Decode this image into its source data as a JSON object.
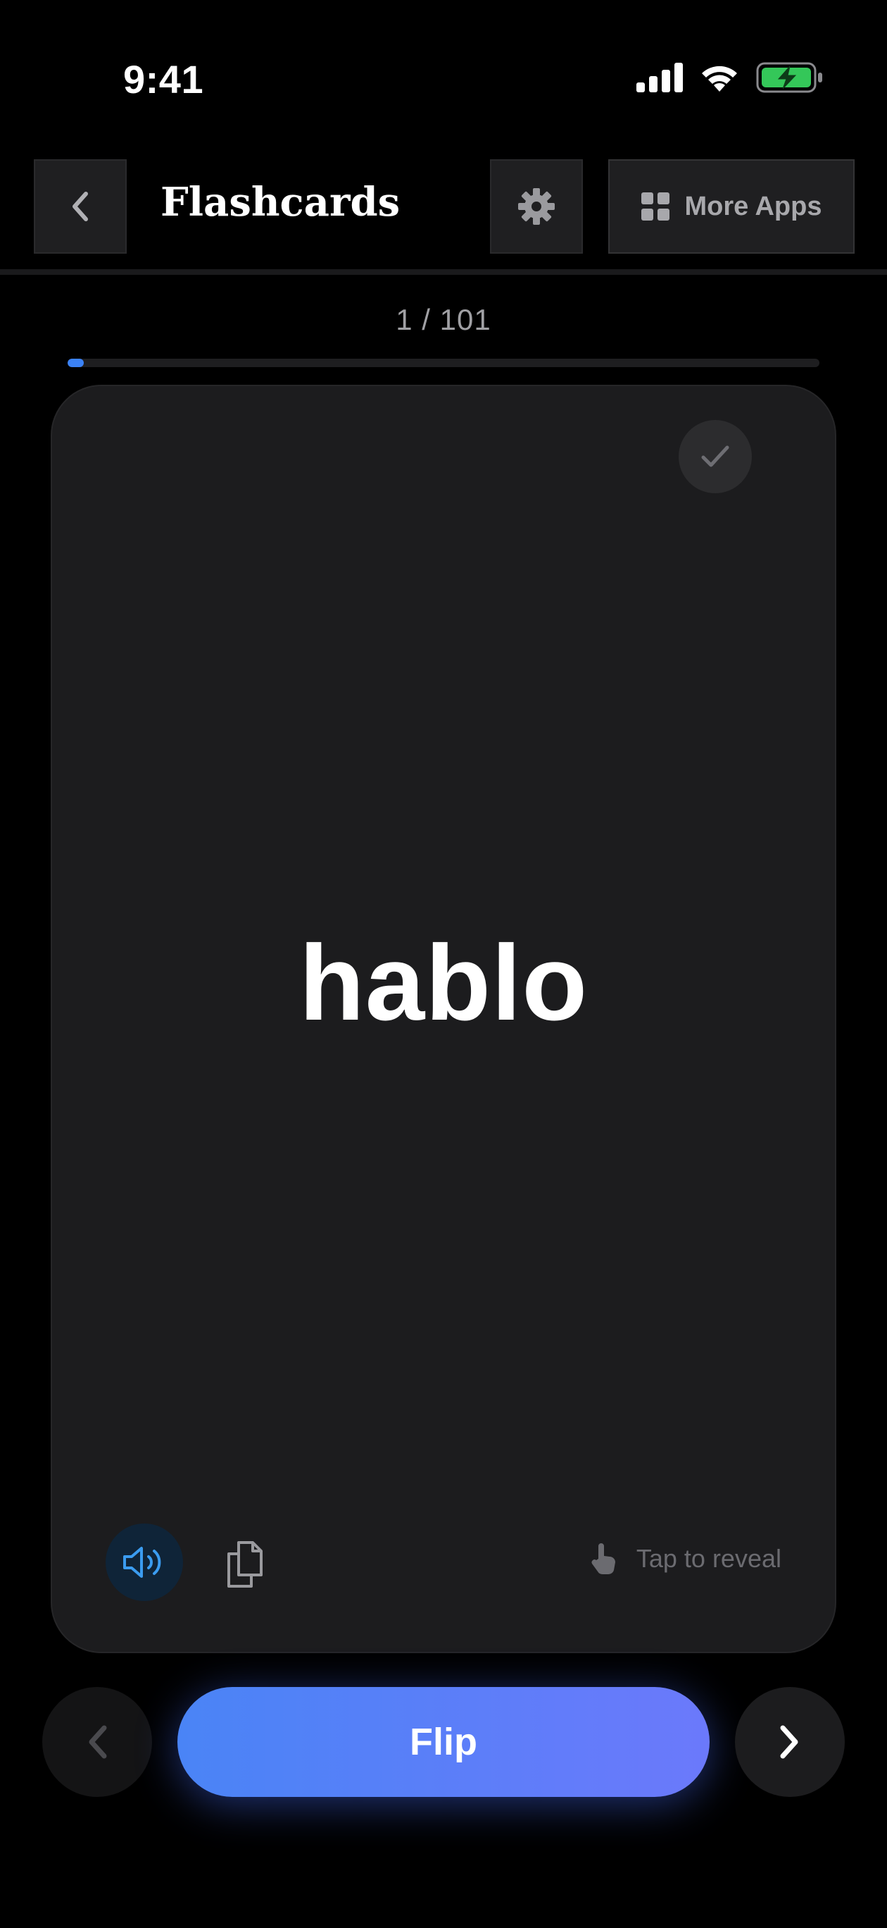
{
  "status_bar": {
    "time": "9:41"
  },
  "header": {
    "title": "Flashcards",
    "more_apps_label": "More Apps",
    "icons": {
      "back": "chevron-left-icon",
      "settings": "gear-icon",
      "apps": "grid-icon"
    }
  },
  "progress": {
    "label": "1 / 101",
    "current": 1,
    "total": 101
  },
  "card": {
    "word": "hablo",
    "reveal_hint": "Tap to reveal",
    "icons": {
      "known": "checkmark-icon",
      "speak": "speaker-icon",
      "copy": "copy-icon",
      "reveal": "tap-hand-icon"
    }
  },
  "nav": {
    "flip_label": "Flip",
    "icons": {
      "prev": "chevron-left-icon",
      "next": "chevron-right-icon"
    }
  },
  "colors": {
    "accent": "#3b82f6",
    "flip_gradient_start": "#4a84f6",
    "flip_gradient_end": "#6b79fb",
    "battery": "#34c759",
    "card_bg": "#1c1c1e"
  }
}
